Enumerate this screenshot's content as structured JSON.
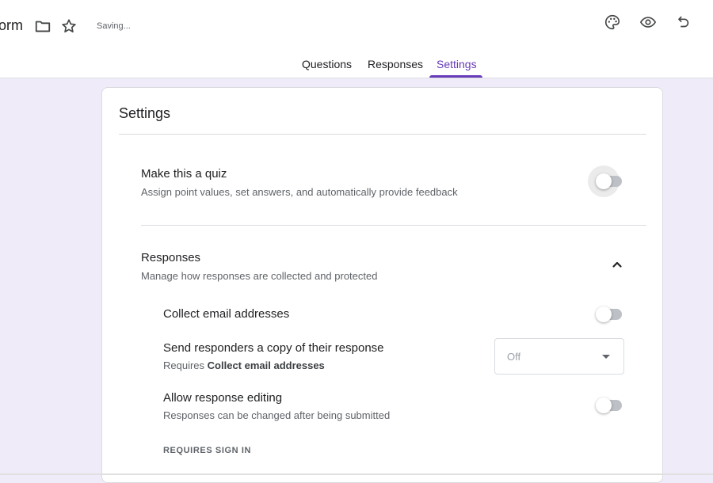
{
  "header": {
    "title_fragment": "orm",
    "saving_text": "Saving...",
    "icons": [
      "folder-icon",
      "star-icon",
      "palette-icon",
      "eye-icon",
      "undo-icon"
    ]
  },
  "tabs": [
    {
      "label": "Questions",
      "active": false
    },
    {
      "label": "Responses",
      "active": false
    },
    {
      "label": "Settings",
      "active": true
    }
  ],
  "settings": {
    "title": "Settings",
    "quiz": {
      "title": "Make this a quiz",
      "description": "Assign point values, set answers, and automatically provide feedback",
      "enabled": false
    },
    "responses": {
      "title": "Responses",
      "description": "Manage how responses are collected and protected",
      "expanded": true,
      "collect_email": {
        "title": "Collect email addresses",
        "enabled": false
      },
      "send_copy": {
        "title": "Send responders a copy of their response",
        "requires_prefix": "Requires",
        "requires_bold": "Collect email addresses",
        "selected": "Off"
      },
      "allow_editing": {
        "title": "Allow response editing",
        "description": "Responses can be changed after being submitted",
        "enabled": false
      },
      "requires_sign_in_label": "REQUIRES SIGN IN"
    }
  },
  "colors": {
    "accent": "#673ab7",
    "background": "#f0ebf8"
  }
}
